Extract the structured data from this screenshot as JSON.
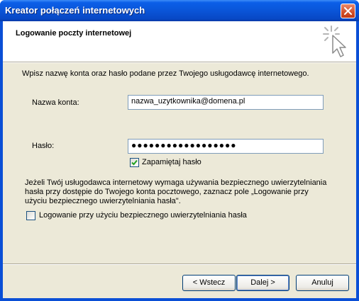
{
  "window": {
    "title": "Kreator połączeń internetowych"
  },
  "header": {
    "title": "Logowanie poczty internetowej"
  },
  "body": {
    "intro": "Wpisz nazwę konta oraz hasło podane przez Twojego usługodawcę internetowego.",
    "account_label": "Nazwa konta:",
    "account_value": "nazwa_uzytkownika@domena.pl",
    "password_label": "Hasło:",
    "password_value": "●●●●●●●●●●●●●●●●●●",
    "remember_label": "Zapamiętaj hasło",
    "remember_checked": true,
    "spa_note_line1": "Jeżeli Twój usługodawca internetowy wymaga używania bezpiecznego uwierzytelniania",
    "spa_note_line2": "hasła przy dostępie do Twojego konta pocztowego, zaznacz pole „Logowanie przy",
    "spa_note_line3": "użyciu bezpiecznego uwierzytelniania hasła\".",
    "spa_label": "Logowanie przy użyciu bezpiecznego uwierzytelniania hasła",
    "spa_checked": false
  },
  "buttons": {
    "back": "< Wstecz",
    "next": "Dalej >",
    "cancel": "Anuluj"
  },
  "colors": {
    "titlebar": "#0a55d8",
    "client": "#ece9d8",
    "check": "#21a121"
  },
  "icons": {
    "close": "close-icon",
    "wizard": "wizard-cursor-icon",
    "check": "check-icon"
  }
}
